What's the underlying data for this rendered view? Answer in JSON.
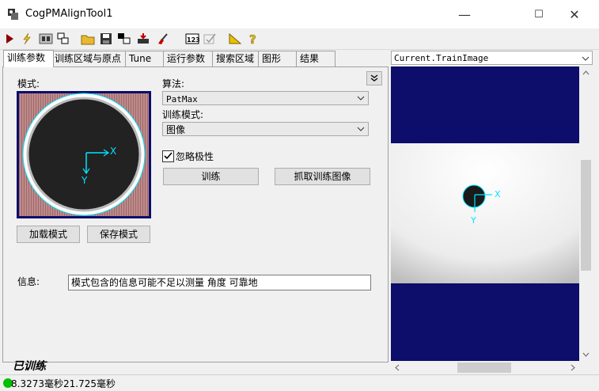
{
  "window": {
    "title": "CogPMAlignTool1",
    "minimize": "—",
    "maximize": "☐",
    "close": "✕"
  },
  "toolbar": {
    "icons": [
      "run-icon",
      "lightning-icon",
      "image-display-icon",
      "windows-icon",
      "open-folder-icon",
      "save-icon",
      "copy-image-icon",
      "import-icon",
      "clear-icon",
      "number-123-icon",
      "checkmark-icon",
      "ruler-icon",
      "help-icon"
    ]
  },
  "tabs": [
    "训练参数",
    "训练区域与原点",
    "Tune",
    "运行参数",
    "搜索区域",
    "图形",
    "结果"
  ],
  "train": {
    "pattern_label": "模式:",
    "algorithm_label": "算法:",
    "algorithm_value": "PatMax",
    "train_mode_label": "训练模式:",
    "train_mode_value": "图像",
    "ignore_polarity_label": "忽略极性",
    "ignore_polarity_checked": true,
    "train_button": "训练",
    "grab_train_image_button": "抓取训练图像",
    "load_pattern_button": "加载模式",
    "save_pattern_button": "保存模式",
    "info_label": "信息:",
    "info_text": "模式包含的信息可能不足以测量 角度 可靠地",
    "trained_status": "已训练",
    "axis_x": "X",
    "axis_y": "Y"
  },
  "status": {
    "indicator_color": "#00c000",
    "time_text": "8.3273毫秒21.725毫秒"
  },
  "view": {
    "image_selector_value": "Current.TrainImage",
    "axis_x": "X",
    "axis_y": "Y"
  },
  "colors": {
    "display_bg": "#0d0d6b",
    "graphics": "#00e5ff"
  }
}
